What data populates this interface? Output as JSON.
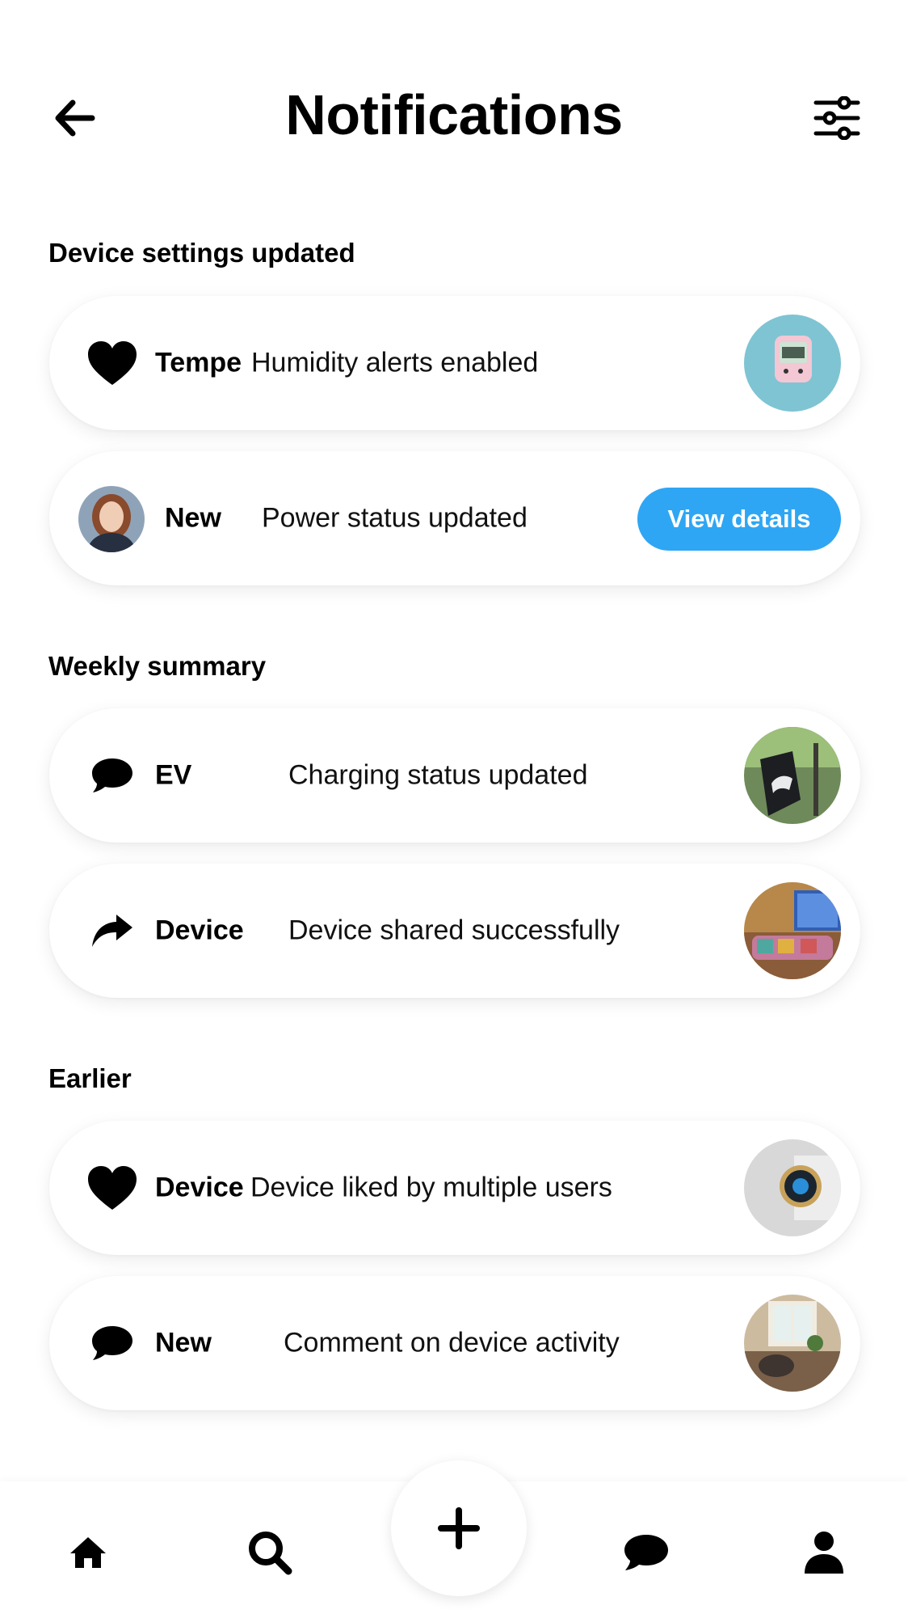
{
  "header": {
    "title": "Notifications",
    "back_icon": "arrow-left-icon",
    "filter_icon": "sliders-icon"
  },
  "sections": [
    {
      "title": "Device settings updated",
      "items": [
        {
          "icon": "heart-icon",
          "name": "Tempe",
          "message": "Humidity alerts enabled",
          "thumb": "thermostat-photo"
        },
        {
          "avatar": "user-avatar-photo",
          "name": "New",
          "message": "Power status updated",
          "action_label": "View details"
        }
      ]
    },
    {
      "title": "Weekly summary",
      "items": [
        {
          "icon": "chat-bubble-icon",
          "name": "EV",
          "message": "Charging status updated",
          "thumb": "ev-charger-photo"
        },
        {
          "icon": "share-arrow-icon",
          "name": "Device",
          "message": "Device shared successfully",
          "thumb": "living-room-photo"
        }
      ]
    },
    {
      "title": "Earlier",
      "items": [
        {
          "icon": "heart-icon",
          "name": "Device",
          "message": "Device liked by multiple users",
          "thumb": "smart-thermostat-photo"
        },
        {
          "icon": "chat-bubble-icon",
          "name": "New",
          "message": "Comment on device activity",
          "thumb": "home-interior-photo"
        }
      ]
    }
  ],
  "bottom_nav": {
    "items": [
      "home-icon",
      "search-icon",
      "plus-icon",
      "chat-bubble-icon",
      "person-icon"
    ]
  },
  "colors": {
    "accent": "#2ea6f4",
    "text": "#000000",
    "background": "#ffffff"
  }
}
